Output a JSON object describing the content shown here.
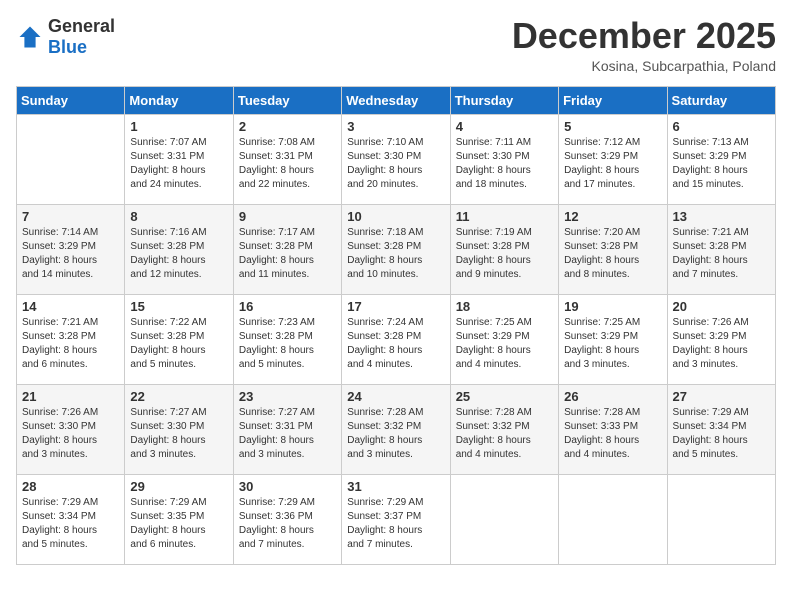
{
  "header": {
    "logo": {
      "general": "General",
      "blue": "Blue"
    },
    "title": "December 2025",
    "location": "Kosina, Subcarpathia, Poland"
  },
  "days_of_week": [
    "Sunday",
    "Monday",
    "Tuesday",
    "Wednesday",
    "Thursday",
    "Friday",
    "Saturday"
  ],
  "weeks": [
    [
      {
        "day": "",
        "info": ""
      },
      {
        "day": "1",
        "info": "Sunrise: 7:07 AM\nSunset: 3:31 PM\nDaylight: 8 hours\nand 24 minutes."
      },
      {
        "day": "2",
        "info": "Sunrise: 7:08 AM\nSunset: 3:31 PM\nDaylight: 8 hours\nand 22 minutes."
      },
      {
        "day": "3",
        "info": "Sunrise: 7:10 AM\nSunset: 3:30 PM\nDaylight: 8 hours\nand 20 minutes."
      },
      {
        "day": "4",
        "info": "Sunrise: 7:11 AM\nSunset: 3:30 PM\nDaylight: 8 hours\nand 18 minutes."
      },
      {
        "day": "5",
        "info": "Sunrise: 7:12 AM\nSunset: 3:29 PM\nDaylight: 8 hours\nand 17 minutes."
      },
      {
        "day": "6",
        "info": "Sunrise: 7:13 AM\nSunset: 3:29 PM\nDaylight: 8 hours\nand 15 minutes."
      }
    ],
    [
      {
        "day": "7",
        "info": "Sunrise: 7:14 AM\nSunset: 3:29 PM\nDaylight: 8 hours\nand 14 minutes."
      },
      {
        "day": "8",
        "info": "Sunrise: 7:16 AM\nSunset: 3:28 PM\nDaylight: 8 hours\nand 12 minutes."
      },
      {
        "day": "9",
        "info": "Sunrise: 7:17 AM\nSunset: 3:28 PM\nDaylight: 8 hours\nand 11 minutes."
      },
      {
        "day": "10",
        "info": "Sunrise: 7:18 AM\nSunset: 3:28 PM\nDaylight: 8 hours\nand 10 minutes."
      },
      {
        "day": "11",
        "info": "Sunrise: 7:19 AM\nSunset: 3:28 PM\nDaylight: 8 hours\nand 9 minutes."
      },
      {
        "day": "12",
        "info": "Sunrise: 7:20 AM\nSunset: 3:28 PM\nDaylight: 8 hours\nand 8 minutes."
      },
      {
        "day": "13",
        "info": "Sunrise: 7:21 AM\nSunset: 3:28 PM\nDaylight: 8 hours\nand 7 minutes."
      }
    ],
    [
      {
        "day": "14",
        "info": "Sunrise: 7:21 AM\nSunset: 3:28 PM\nDaylight: 8 hours\nand 6 minutes."
      },
      {
        "day": "15",
        "info": "Sunrise: 7:22 AM\nSunset: 3:28 PM\nDaylight: 8 hours\nand 5 minutes."
      },
      {
        "day": "16",
        "info": "Sunrise: 7:23 AM\nSunset: 3:28 PM\nDaylight: 8 hours\nand 5 minutes."
      },
      {
        "day": "17",
        "info": "Sunrise: 7:24 AM\nSunset: 3:28 PM\nDaylight: 8 hours\nand 4 minutes."
      },
      {
        "day": "18",
        "info": "Sunrise: 7:25 AM\nSunset: 3:29 PM\nDaylight: 8 hours\nand 4 minutes."
      },
      {
        "day": "19",
        "info": "Sunrise: 7:25 AM\nSunset: 3:29 PM\nDaylight: 8 hours\nand 3 minutes."
      },
      {
        "day": "20",
        "info": "Sunrise: 7:26 AM\nSunset: 3:29 PM\nDaylight: 8 hours\nand 3 minutes."
      }
    ],
    [
      {
        "day": "21",
        "info": "Sunrise: 7:26 AM\nSunset: 3:30 PM\nDaylight: 8 hours\nand 3 minutes."
      },
      {
        "day": "22",
        "info": "Sunrise: 7:27 AM\nSunset: 3:30 PM\nDaylight: 8 hours\nand 3 minutes."
      },
      {
        "day": "23",
        "info": "Sunrise: 7:27 AM\nSunset: 3:31 PM\nDaylight: 8 hours\nand 3 minutes."
      },
      {
        "day": "24",
        "info": "Sunrise: 7:28 AM\nSunset: 3:32 PM\nDaylight: 8 hours\nand 3 minutes."
      },
      {
        "day": "25",
        "info": "Sunrise: 7:28 AM\nSunset: 3:32 PM\nDaylight: 8 hours\nand 4 minutes."
      },
      {
        "day": "26",
        "info": "Sunrise: 7:28 AM\nSunset: 3:33 PM\nDaylight: 8 hours\nand 4 minutes."
      },
      {
        "day": "27",
        "info": "Sunrise: 7:29 AM\nSunset: 3:34 PM\nDaylight: 8 hours\nand 5 minutes."
      }
    ],
    [
      {
        "day": "28",
        "info": "Sunrise: 7:29 AM\nSunset: 3:34 PM\nDaylight: 8 hours\nand 5 minutes."
      },
      {
        "day": "29",
        "info": "Sunrise: 7:29 AM\nSunset: 3:35 PM\nDaylight: 8 hours\nand 6 minutes."
      },
      {
        "day": "30",
        "info": "Sunrise: 7:29 AM\nSunset: 3:36 PM\nDaylight: 8 hours\nand 7 minutes."
      },
      {
        "day": "31",
        "info": "Sunrise: 7:29 AM\nSunset: 3:37 PM\nDaylight: 8 hours\nand 7 minutes."
      },
      {
        "day": "",
        "info": ""
      },
      {
        "day": "",
        "info": ""
      },
      {
        "day": "",
        "info": ""
      }
    ]
  ]
}
